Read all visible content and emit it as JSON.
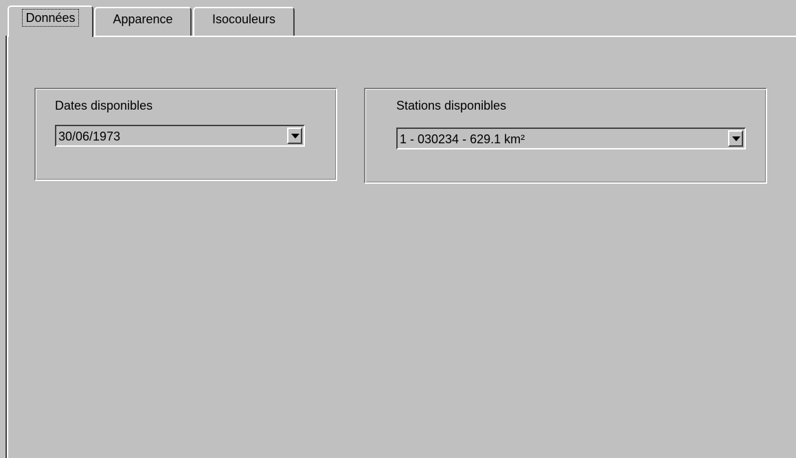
{
  "tabs": [
    {
      "label": "Données",
      "active": true
    },
    {
      "label": "Apparence",
      "active": false
    },
    {
      "label": "Isocouleurs",
      "active": false
    }
  ],
  "dates_group": {
    "label": "Dates disponibles",
    "selected": "30/06/1973"
  },
  "stations_group": {
    "label": "Stations disponibles",
    "selected": "1 - 030234 - 629.1 km²"
  },
  "colors": {
    "face": "#c0c0c0",
    "highlight": "#ffffff",
    "shadow": "#808080"
  }
}
